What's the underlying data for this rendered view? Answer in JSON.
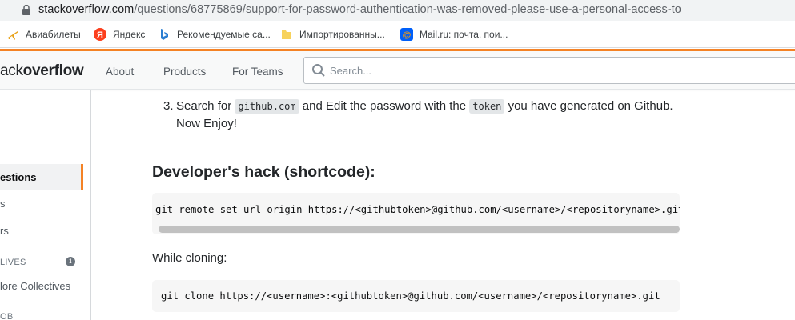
{
  "browser": {
    "url_domain": "stackoverflow.com",
    "url_path": "/questions/68775869/support-for-password-authentication-was-removed-please-use-a-personal-access-to",
    "bookmarks": [
      {
        "label": "Авиабилеты",
        "icon": "airplane-icon"
      },
      {
        "label": "Яндекс",
        "icon": "yandex-icon"
      },
      {
        "label": "Рекомендуемые са...",
        "icon": "bing-icon"
      },
      {
        "label": "Импортированны...",
        "icon": "folder-icon"
      },
      {
        "label": "Mail.ru: почта, пои...",
        "icon": "mailru-icon"
      }
    ]
  },
  "header": {
    "logo_prefix": "ack",
    "logo_bold": "overflow",
    "nav": [
      "About",
      "Products",
      "For Teams"
    ],
    "search_placeholder": "Search..."
  },
  "sidebar": {
    "active_item": "estions",
    "item_s": "s",
    "item_rs": "rs",
    "collectives_heading": "LIVES",
    "explore_collectives": "lore Collectives",
    "heading_ob": "OB"
  },
  "answer": {
    "step_number": "3.",
    "step_text_1": "Search for",
    "step_code_1": "github.com",
    "step_text_2": "and Edit the password with the",
    "step_code_2": "token",
    "step_text_3": "you have generated on Github.",
    "step_text_4": "Now Enjoy!",
    "heading": "Developer's hack (shortcode):",
    "code_1": "git remote set-url origin https://<githubtoken>@github.com/<username>/<repositoryname>.git",
    "cloning_label": "While cloning:",
    "code_2": "git clone https://<username>:<githubtoken>@github.com/<username>/<repositoryname>.git"
  },
  "colors": {
    "accent": "#f48225",
    "code_bg": "#f6f6f6"
  }
}
